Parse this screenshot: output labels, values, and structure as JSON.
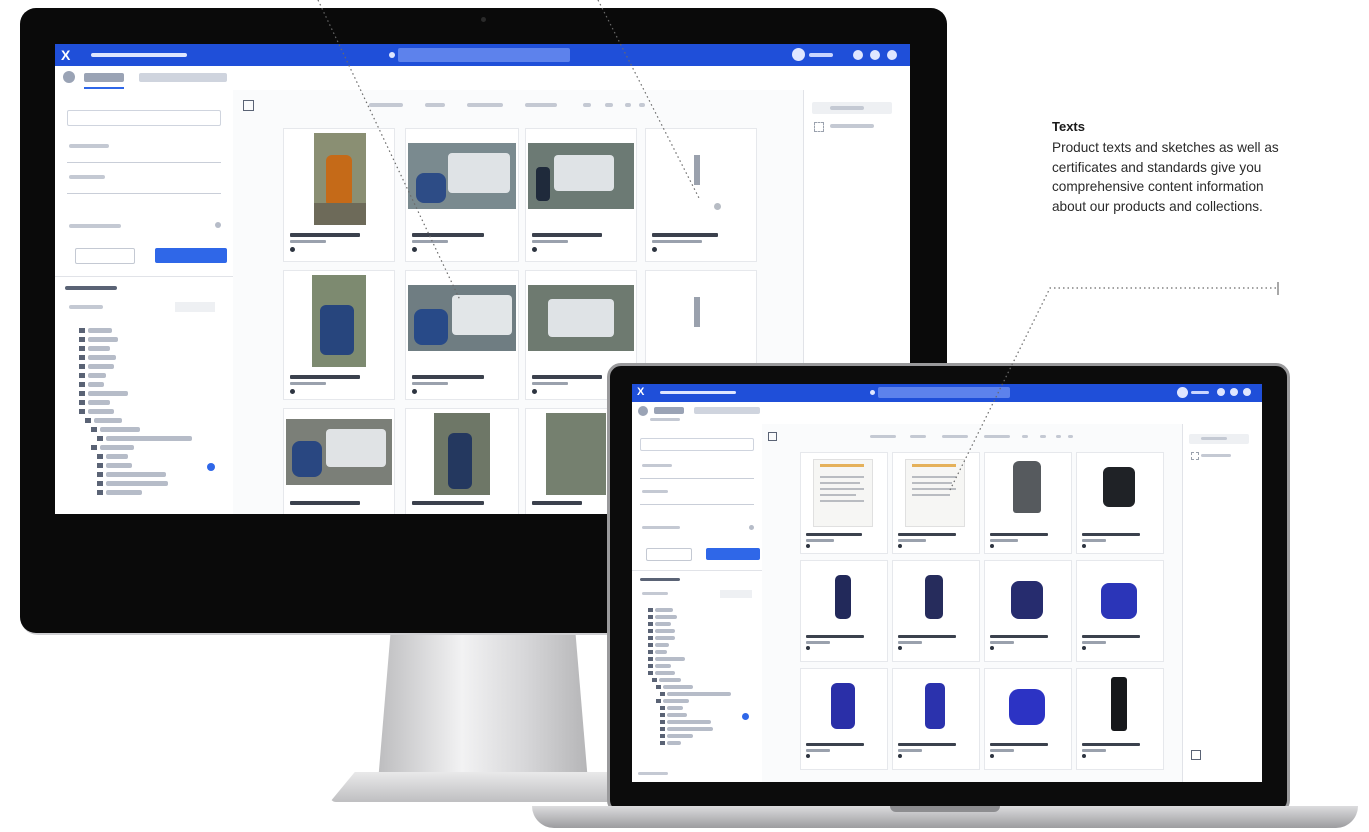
{
  "callout": {
    "title": "Texts",
    "text": "Product texts and sketches as well as certificates and standards give you comprehensive content information about our products and collections."
  },
  "colors": {
    "topbar": "#1f4fd9",
    "primary_button": "#2f67e8",
    "screen_bg": "#f4f5f8"
  },
  "icons": {
    "logo": "x-logo-icon",
    "user": "avatar-icon",
    "folder": "folder-icon",
    "toggle_panel": "sidebar-toggle-icon"
  }
}
